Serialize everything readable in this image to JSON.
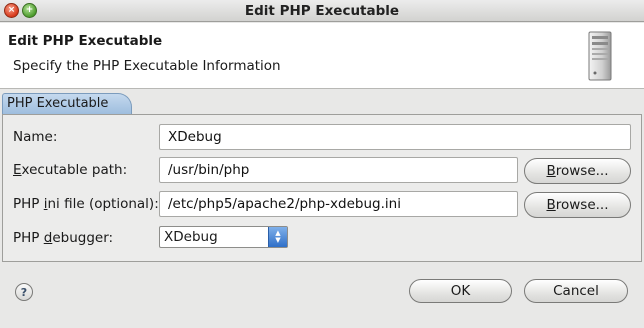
{
  "window": {
    "title": "Edit PHP Executable",
    "close_glyph": "×",
    "max_glyph": "+"
  },
  "header": {
    "title": "Edit PHP Executable",
    "subtitle": "Specify the PHP Executable Information",
    "icon": "server-icon"
  },
  "tab": {
    "label": "PHP Executable"
  },
  "form": {
    "name": {
      "label": "Name:",
      "value": "XDebug"
    },
    "exec_path": {
      "label_pre": "",
      "label_acc": "E",
      "label_post": "xecutable path:",
      "value": "/usr/bin/php",
      "browse_acc": "B",
      "browse_rest": "rowse..."
    },
    "ini_file": {
      "label_pre": "PHP ",
      "label_acc": "i",
      "label_post": "ni file (optional):",
      "value": "/etc/php5/apache2/php-xdebug.ini",
      "browse_acc": "B",
      "browse_rest": "rowse..."
    },
    "debugger": {
      "label_pre": "PHP ",
      "label_acc": "d",
      "label_post": "ebugger:",
      "selected": "XDebug",
      "arrow_up": "▲",
      "arrow_down": "▼"
    }
  },
  "footer": {
    "help_glyph": "?",
    "ok_label": "OK",
    "cancel_label": "Cancel"
  }
}
